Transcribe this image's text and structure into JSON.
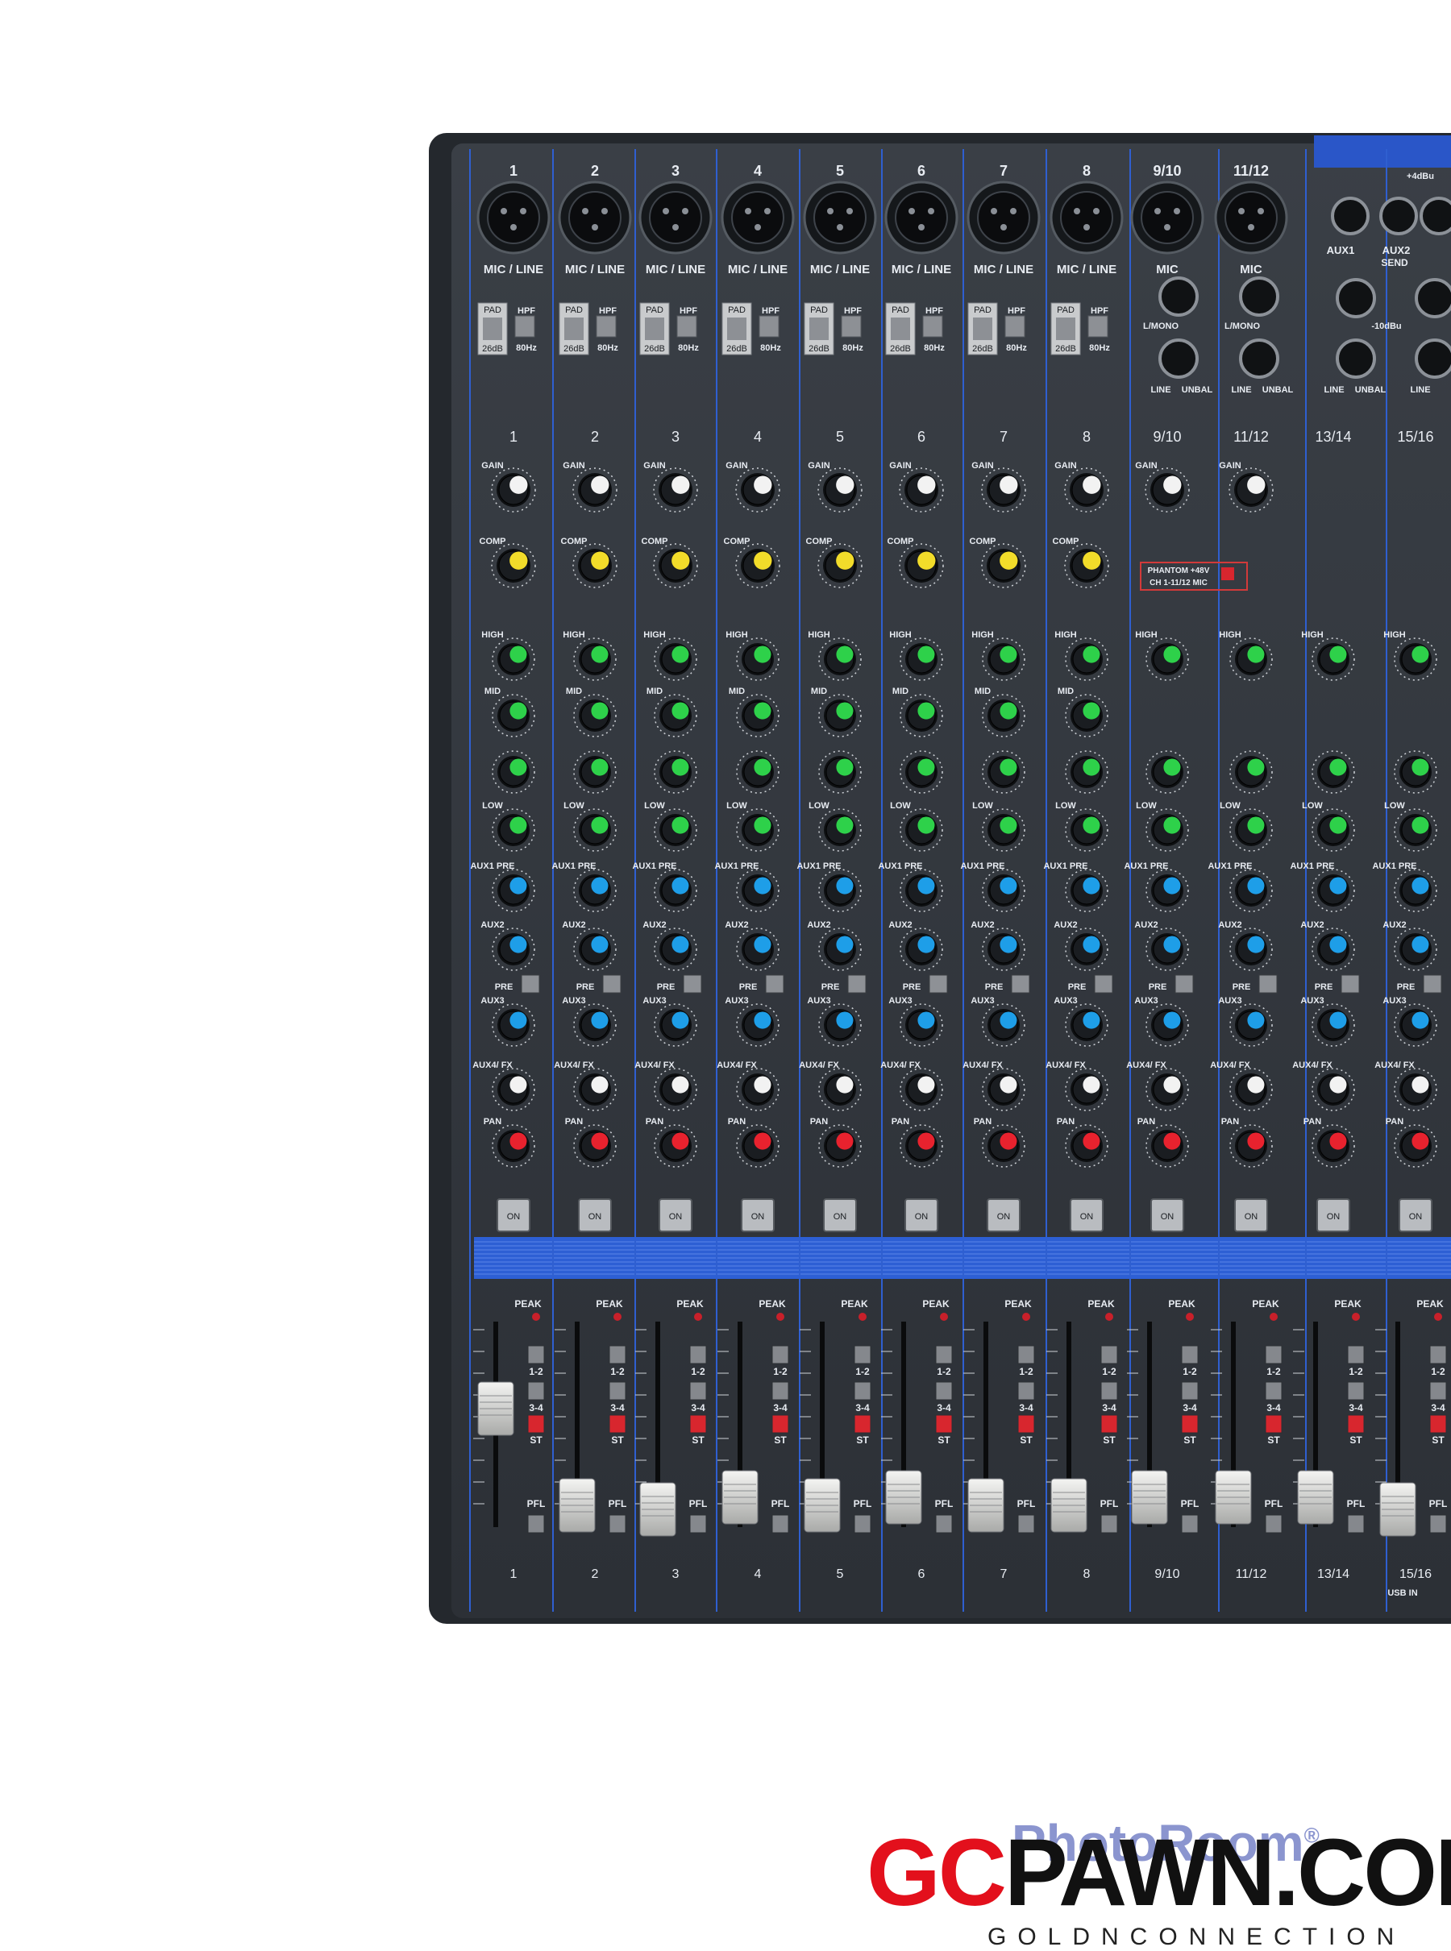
{
  "photo": {
    "subject": "analog mixing console"
  },
  "top_channels": [
    "1",
    "2",
    "3",
    "4",
    "5",
    "6",
    "7",
    "8",
    "9/10",
    "11/12"
  ],
  "mid_channels": [
    "1",
    "2",
    "3",
    "4",
    "5",
    "6",
    "7",
    "8",
    "9/10",
    "11/12",
    "13/14",
    "15/16"
  ],
  "bottom_channels": [
    "1",
    "2",
    "3",
    "4",
    "5",
    "6",
    "7",
    "8",
    "9/10",
    "11/12",
    "13/14",
    "15/16"
  ],
  "labels": {
    "mic_line": "MIC / LINE",
    "mic": "MIC",
    "pad": "PAD",
    "pad_value": "26dB",
    "hpf": "HPF",
    "hpf_value": "80Hz",
    "lmono": "L/MONO",
    "line": "LINE",
    "unbal": "UNBAL",
    "gain": "GAIN",
    "comp": "COMP",
    "high": "HIGH",
    "mid": "MID",
    "low": "LOW",
    "aux1": "AUX1 PRE",
    "aux2": "AUX2",
    "aux3": "AUX3",
    "aux4": "AUX4/ FX",
    "pan": "PAN",
    "pre": "PRE",
    "on": "ON",
    "peak": "PEAK",
    "pfl": "PFL",
    "bus12": "1-2",
    "bus34": "3-4",
    "st": "ST",
    "phantom": "PHANTOM +48V",
    "phantom_sub": "CH 1-11/12 MIC",
    "usb_in": "USB IN",
    "send": "SEND",
    "aux1_jack": "AUX1",
    "aux2_jack": "AUX2",
    "plus4": "+4dBu",
    "minus10": "-10dBu"
  },
  "knob_colors": {
    "gain": "#f2f2f2",
    "comp": "#f2dc2a",
    "eq": "#2ed14a",
    "aux": "#1e9ee8",
    "fx": "#f2f2f2",
    "pan": "#e8222e"
  },
  "watermark": {
    "text": "PhotoRoom",
    "mark": "®"
  },
  "logo": {
    "gc": "GC",
    "rest": "PAWN.COM",
    "tagline": "GOLDNCONNECTION"
  }
}
